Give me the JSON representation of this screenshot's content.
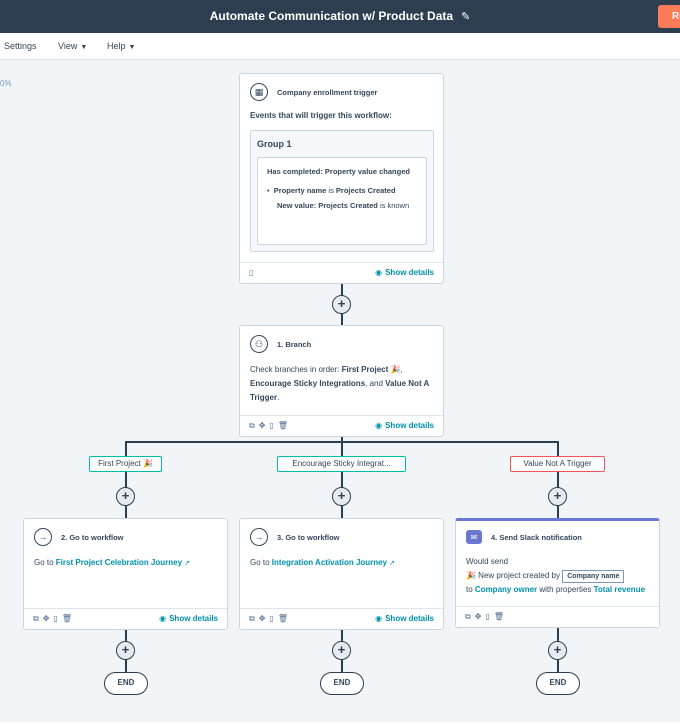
{
  "header": {
    "title": "Automate Communication w/ Product Data",
    "review_label": "Re"
  },
  "menu": {
    "settings": "Settings",
    "view": "View",
    "help": "Help"
  },
  "zoom": "0%",
  "trigger": {
    "title": "Company enrollment trigger",
    "intro": "Events that will trigger this workflow:",
    "group_title": "Group 1",
    "event_label": "Has completed: Property value changed",
    "bullet_key": "Property name",
    "bullet_op": " is ",
    "bullet_val": "Projects Created",
    "newval_key": "New value: Projects Created",
    "newval_suffix": " is known",
    "show_details": "Show details"
  },
  "branch": {
    "title": "1. Branch",
    "text_prefix": "Check branches in order: ",
    "b1": "First Project 🎉",
    "sep1": ", ",
    "b2": "Encourage Sticky Integrations",
    "sep2": ", and ",
    "b3": "Value Not A Trigger",
    "end": ".",
    "show_details": "Show details"
  },
  "branch_labels": [
    "First Project 🎉",
    "Encourage Sticky Integrat...",
    "Value Not A Trigger"
  ],
  "action2": {
    "title": "2. Go to workflow",
    "prefix": "Go to ",
    "target": "First Project Celebration Journey",
    "show_details": "Show details"
  },
  "action3": {
    "title": "3. Go to workflow",
    "prefix": "Go to ",
    "target": "Integration Activation Journey",
    "show_details": "Show details"
  },
  "action4": {
    "title": "4. Send Slack notification",
    "line1": "Would send",
    "line2_prefix": "🎉 New project created by",
    "token": "Company name",
    "line3_prefix": "to ",
    "owner": "Company owner",
    "line3_mid": " with properties ",
    "props": "Total revenue"
  },
  "end_label": "END",
  "colors": {
    "topbar": "#2d3e50",
    "accent": "#ff7a59",
    "link": "#0091ae",
    "branch1_border": "#00bda5",
    "branch3_border": "#f2545b",
    "slack_bar": "#6a78d1"
  }
}
